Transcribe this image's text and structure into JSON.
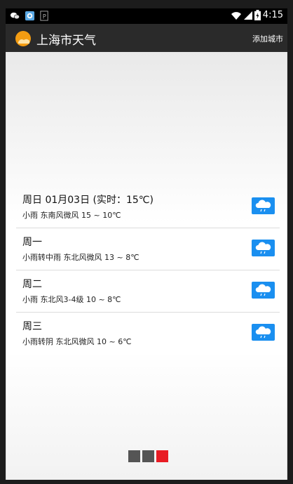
{
  "status_bar": {
    "time": "4:15",
    "left_icons": [
      "wechat-icon",
      "gallery-icon",
      "parking-icon"
    ],
    "right_icons": [
      "wifi-icon",
      "signal-icon",
      "battery-icon"
    ]
  },
  "action_bar": {
    "title": "上海市天气",
    "add_city_label": "添加城市"
  },
  "forecast": [
    {
      "title": "周日 01月03日 (实时：15℃)",
      "desc": "小雨 东南风微风 15 ~ 10℃",
      "icon": "light-rain-icon"
    },
    {
      "title": "周一",
      "desc": "小雨转中雨 东北风微风 13 ~ 8℃",
      "icon": "light-rain-icon"
    },
    {
      "title": "周二",
      "desc": "小雨 东北风3-4级 10 ~ 8℃",
      "icon": "light-rain-icon"
    },
    {
      "title": "周三",
      "desc": "小雨转阴 东北风微风 10 ~ 6℃",
      "icon": "light-rain-icon"
    }
  ],
  "pager": {
    "count": 3,
    "active_index": 2
  },
  "colors": {
    "icon_blue": "#1a8ff0",
    "pager_active": "#e81c24",
    "pager_inactive": "#555555"
  }
}
